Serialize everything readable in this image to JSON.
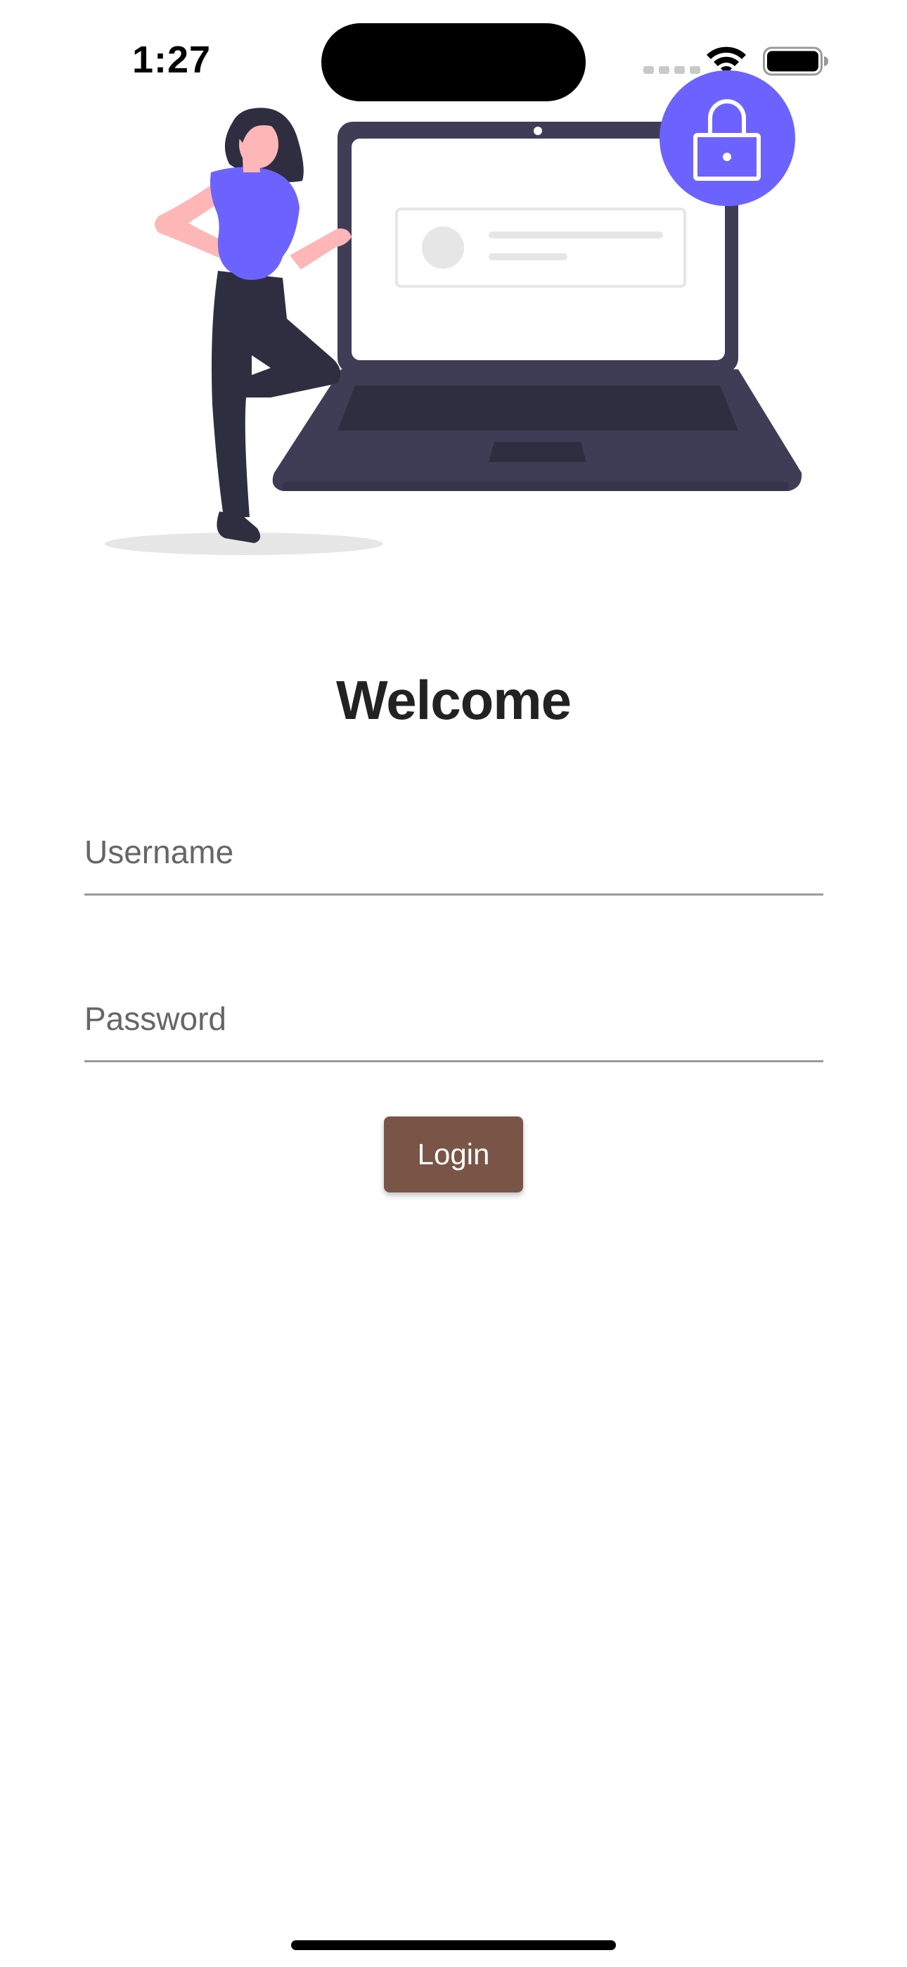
{
  "status_bar": {
    "time": "1:27"
  },
  "icons": {
    "lock": "lock-icon",
    "wifi": "wifi-icon",
    "battery": "battery-icon",
    "signal": "cellular-signal-icon"
  },
  "colors": {
    "accent": "#6c63ff",
    "button": "#795548",
    "button_text": "#ffffff",
    "laptop": "#3f3d56",
    "text": "#222222"
  },
  "form": {
    "title": "Welcome",
    "username": {
      "placeholder": "Username",
      "value": ""
    },
    "password": {
      "placeholder": "Password",
      "value": ""
    },
    "login_label": "Login"
  }
}
